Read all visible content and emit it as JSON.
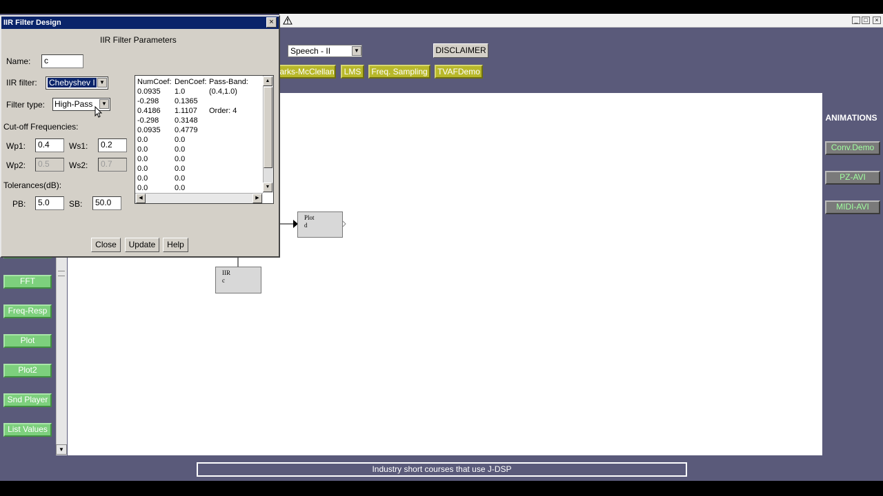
{
  "app": {
    "speech_select": "Speech - II",
    "disclaimer_label": "DISCLAIMER",
    "top_buttons": [
      "arks-McClellan",
      "LMS",
      "Freq. Sampling",
      "TVAFDemo"
    ],
    "left_buttons": [
      "FFT",
      "Freq-Resp",
      "Plot",
      "Plot2",
      "Snd Player",
      "List Values"
    ],
    "animations_heading": "ANIMATIONS",
    "right_buttons": [
      "Conv.Demo",
      "PZ-AVI",
      "MIDI-AVI"
    ],
    "blocks": {
      "plot": {
        "name": "Plot",
        "id": "d"
      },
      "iir": {
        "name": "IIR",
        "id": "c"
      }
    },
    "banner": "Industry short courses that use J-DSP",
    "warning_icon": "warning-icon",
    "window_controls": [
      "_",
      "□",
      "×"
    ]
  },
  "dialog": {
    "title": "IIR Filter Design",
    "heading": "IIR Filter Parameters",
    "close_x": "×",
    "name_label": "Name:",
    "name_value": "c",
    "iir_filter_label": "IIR filter:",
    "iir_filter_value": "Chebyshev I",
    "filter_type_label": "Filter type:",
    "filter_type_value": "High-Pass",
    "cutoff_label": "Cut-off Frequencies:",
    "wp1_label": "Wp1:",
    "wp1_value": "0.4",
    "ws1_label": "Ws1:",
    "ws1_value": "0.2",
    "wp2_label": "Wp2:",
    "wp2_value": "0.5",
    "ws2_label": "Ws2:",
    "ws2_value": "0.7",
    "tolerances_label": "Tolerances(dB):",
    "pb_label": "PB:",
    "pb_value": "5.0",
    "sb_label": "SB:",
    "sb_value": "50.0",
    "coef_headers": [
      "NumCoef:",
      "DenCoef:",
      "Pass-Band:"
    ],
    "coef_rows": [
      [
        "0.0935",
        "1.0",
        "(0.4,1.0)"
      ],
      [
        "-0.298",
        "0.1365",
        ""
      ],
      [
        "0.4186",
        "1.1107",
        "Order: 4"
      ],
      [
        "-0.298",
        "0.3148",
        ""
      ],
      [
        "0.0935",
        "0.4779",
        ""
      ],
      [
        "0.0",
        "0.0",
        ""
      ],
      [
        "0.0",
        "0.0",
        ""
      ],
      [
        "0.0",
        "0.0",
        ""
      ],
      [
        "0.0",
        "0.0",
        ""
      ],
      [
        "0.0",
        "0.0",
        ""
      ],
      [
        "0.0",
        "0.0",
        ""
      ]
    ],
    "buttons": {
      "close": "Close",
      "update": "Update",
      "help": "Help"
    }
  }
}
